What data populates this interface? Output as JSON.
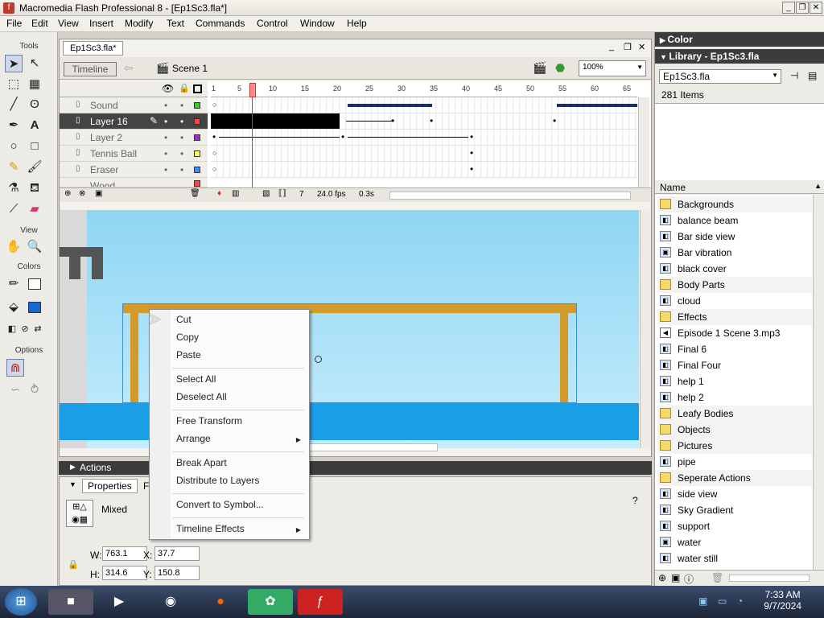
{
  "window": {
    "title": "Macromedia Flash Professional 8 - [Ep1Sc3.fla*]"
  },
  "menu": [
    "File",
    "Edit",
    "View",
    "Insert",
    "Modify",
    "Text",
    "Commands",
    "Control",
    "Window",
    "Help"
  ],
  "tools": {
    "header": "Tools",
    "view_label": "View",
    "colors_label": "Colors",
    "options_label": "Options"
  },
  "document": {
    "tab": "Ep1Sc3.fla*",
    "timeline_button": "Timeline",
    "scene": "Scene 1",
    "zoom": "100%"
  },
  "timeline": {
    "ruler": [
      "1",
      "5",
      "10",
      "15",
      "20",
      "25",
      "30",
      "35",
      "40",
      "45",
      "50",
      "55",
      "60",
      "65"
    ],
    "layers": [
      {
        "name": "Sound",
        "color": "#33cc33"
      },
      {
        "name": "Layer 16",
        "color": "#ff4444"
      },
      {
        "name": "Layer 2",
        "color": "#9933cc"
      },
      {
        "name": "Tennis Ball",
        "color": "#ffff44"
      },
      {
        "name": "Eraser",
        "color": "#4488ff"
      },
      {
        "name": "Wood",
        "color": "#ff4444"
      }
    ],
    "current_frame": "7",
    "fps": "24.0 fps",
    "time": "0.3s"
  },
  "context_menu": {
    "items": [
      "Cut",
      "Copy",
      "Paste",
      "Select All",
      "Deselect All",
      "Free Transform",
      "Arrange",
      "Break Apart",
      "Distribute to Layers",
      "Convert to Symbol...",
      "Timeline Effects"
    ]
  },
  "panels": {
    "actions": "Actions",
    "properties": "Properties",
    "properties_filters_tab": "F",
    "mixed": "Mixed",
    "w_label": "W:",
    "w_value": "763.1",
    "h_label": "H:",
    "h_value": "314.6",
    "x_label": "X:",
    "x_value": "37.7",
    "y_label": "Y:",
    "y_value": "150.8"
  },
  "right": {
    "color_header": "Color",
    "library_header": "Library - Ep1Sc3.fla",
    "library_select": "Ep1Sc3.fla",
    "item_count": "281 Items",
    "name_header": "Name",
    "items": [
      {
        "name": "Backgrounds",
        "type": "folder"
      },
      {
        "name": "balance beam",
        "type": "graphic"
      },
      {
        "name": "Bar side view",
        "type": "graphic"
      },
      {
        "name": "Bar vibration",
        "type": "movie"
      },
      {
        "name": "black cover",
        "type": "graphic"
      },
      {
        "name": "Body Parts",
        "type": "folder"
      },
      {
        "name": "cloud",
        "type": "graphic"
      },
      {
        "name": "Effects",
        "type": "folder"
      },
      {
        "name": "Episode 1 Scene 3.mp3",
        "type": "sound"
      },
      {
        "name": "Final 6",
        "type": "graphic"
      },
      {
        "name": "Final Four",
        "type": "graphic"
      },
      {
        "name": "help 1",
        "type": "graphic"
      },
      {
        "name": "help 2",
        "type": "graphic"
      },
      {
        "name": "Leafy Bodies",
        "type": "folder"
      },
      {
        "name": "Objects",
        "type": "folder"
      },
      {
        "name": "Pictures",
        "type": "folder"
      },
      {
        "name": "pipe",
        "type": "graphic"
      },
      {
        "name": "Seperate Actions",
        "type": "folder"
      },
      {
        "name": "side view",
        "type": "graphic"
      },
      {
        "name": "Sky Gradient",
        "type": "graphic"
      },
      {
        "name": "support",
        "type": "graphic"
      },
      {
        "name": "water",
        "type": "movie"
      },
      {
        "name": "water still",
        "type": "graphic"
      }
    ]
  },
  "taskbar": {
    "time": "7:33 AM",
    "date": "9/7/2024"
  }
}
